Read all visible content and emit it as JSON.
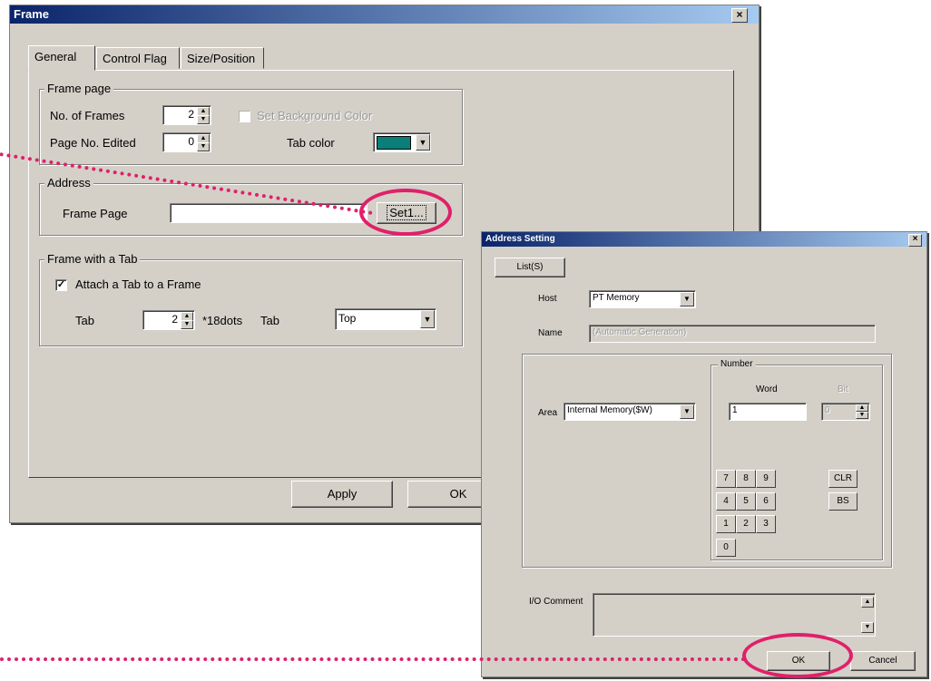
{
  "frame_dialog": {
    "title": "Frame",
    "close_glyph": "×",
    "tabs": [
      "General",
      "Control Flag",
      "Size/Position"
    ],
    "frame_page_group": {
      "legend": "Frame page",
      "no_of_frames_label": "No. of Frames",
      "no_of_frames_value": "2",
      "page_no_edited_label": "Page No. Edited",
      "page_no_edited_value": "0",
      "set_bg_color_label": "Set Background Color",
      "tab_color_label": "Tab color",
      "tab_color": "#0a7f7a"
    },
    "address_group": {
      "legend": "Address",
      "frame_page_label": "Frame Page",
      "frame_page_value": "",
      "set_button": "Set1..."
    },
    "tab_group": {
      "legend": "Frame with a Tab",
      "attach_label": "Attach a Tab  to a Frame",
      "attach_checked": true,
      "tab_label": "Tab",
      "tab_value": "2",
      "unit_label": "*18dots",
      "tab_position_label": "Tab",
      "tab_position_value": "Top"
    },
    "buttons": {
      "apply": "Apply",
      "ok": "OK"
    }
  },
  "address_dialog": {
    "title": "Address Setting",
    "close_glyph": "×",
    "list_button": "List(S)",
    "host_label": "Host",
    "host_value": "PT Memory",
    "name_label": "Name",
    "name_value": "(Automatic Generation)",
    "number_legend": "Number",
    "word_label": "Word",
    "bit_label": "Bit",
    "area_label": "Area",
    "area_value": "Internal Memory($W)",
    "word_value": "1",
    "bit_value": "0",
    "keypad": [
      "7",
      "8",
      "9",
      "4",
      "5",
      "6",
      "1",
      "2",
      "3",
      "0"
    ],
    "clr_button": "CLR",
    "bs_button": "BS",
    "io_comment_label": "I/O Comment",
    "io_comment_value": "",
    "ok_button": "OK",
    "cancel_button": "Cancel"
  },
  "annotation_color": "#e0206a"
}
